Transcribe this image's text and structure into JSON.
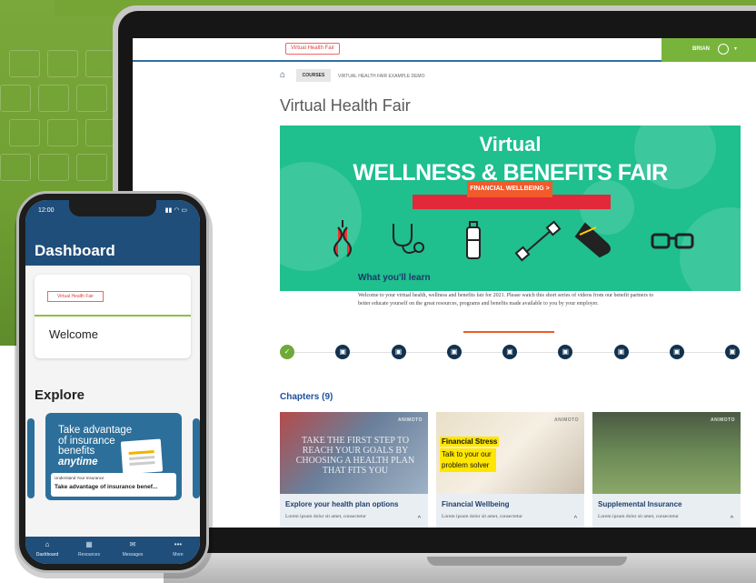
{
  "laptop": {
    "topbar": {
      "course_pill": "Virtual Health Fair",
      "user_name": "BRIAN",
      "user_caret": "▾"
    },
    "breadcrumb": {
      "courses": "COURSES",
      "current": "VIRTUAL HEALTH FAIR EXAMPLE DEMO"
    },
    "page_title": "Virtual Health Fair",
    "hero": {
      "line1": "Virtual",
      "line2": "WELLNESS & BENEFITS FAIR",
      "button_label": "FINANCIAL WELLBEING >",
      "icons": [
        "apple-core-icon",
        "stethoscope-icon",
        "water-bottle-icon",
        "dumbbell-icon",
        "sneaker-icon",
        "glasses-icon"
      ]
    },
    "learn": {
      "title": "What you'll learn",
      "text": "Welcome to your virtual health, wellness and benefits fair for 2021. Please watch this short series of videos from our benefit partners to better educate yourself on the great resources, programs and benefits made available to you by your employer."
    },
    "progress": {
      "completed": 1,
      "total": 9,
      "done_glyph": "✓",
      "pending_glyph": "▣"
    },
    "chapters_title": "Chapters (9)",
    "cards": [
      {
        "title": "Explore your health plan options",
        "desc": "Lorem ipsum dolor sit amet, consectetur",
        "image_text": "TAKE THE FIRST STEP TO REACH YOUR GOALS BY CHOOSING A HEALTH PLAN THAT FITS YOU",
        "badge": "ANIMOTO"
      },
      {
        "title": "Financial Wellbeing",
        "desc": "Lorem ipsum dolor sit amet, consectetur",
        "highlight_title": "Financial Stress",
        "highlight_sub": "Talk to your our problem solver",
        "badge": "ANIMOTO"
      },
      {
        "title": "Supplemental Insurance",
        "desc": "Lorem ipsum dolor sit amet, consectetur",
        "badge": "ANIMOTO"
      }
    ],
    "caret": "^"
  },
  "phone": {
    "time": "12:00",
    "status": "▮▮ ◠ ▭",
    "title": "Dashboard",
    "card_pill": "Virtual Health Fair",
    "welcome": "Welcome",
    "explore": "Explore",
    "promo": {
      "line1": "Take advantage",
      "line2": "of insurance",
      "line3": "benefits",
      "line4": "anytime",
      "caption_small": "Understand Your Insurance",
      "caption_big": "Take advantage of insurance benef..."
    },
    "nav": [
      {
        "label": "Dashboard",
        "icon": "⌂"
      },
      {
        "label": "Resources",
        "icon": "▦"
      },
      {
        "label": "Messages",
        "icon": "✉"
      },
      {
        "label": "More",
        "icon": "•••"
      }
    ]
  },
  "colors": {
    "hero_green": "#1fbf8e",
    "brand_navy": "#1f4e7a",
    "accent_orange": "#f15a2b",
    "user_green": "#78b43c",
    "highlight_yellow": "#ffe600"
  }
}
